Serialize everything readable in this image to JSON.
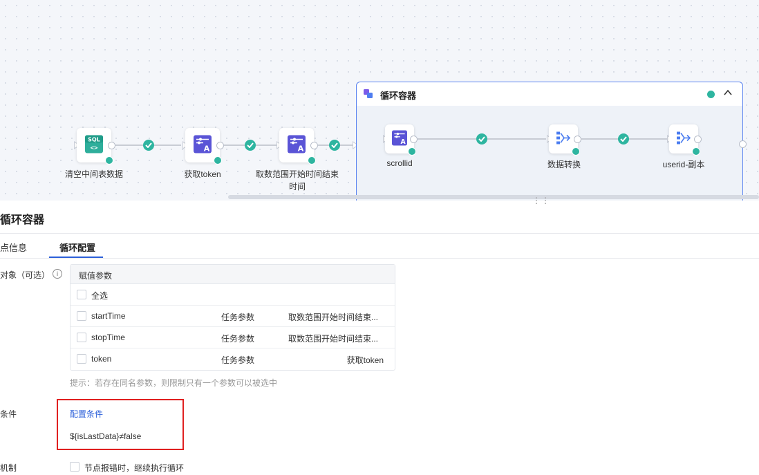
{
  "flow": {
    "nodes": [
      {
        "label": "清空中间表数据",
        "icon": "sql-icon",
        "icon_text": "SQL"
      },
      {
        "label": "获取token",
        "icon": "assign-icon"
      },
      {
        "label_line1": "取数范围开始时间结束",
        "label_line2": "时间",
        "icon": "assign-icon"
      }
    ],
    "container": {
      "title": "循环容器",
      "nodes": [
        {
          "label": "scrollid",
          "icon": "assign-icon"
        },
        {
          "label": "数据转换",
          "icon": "transform-icon"
        },
        {
          "label": "userid-副本",
          "icon": "transform-icon"
        }
      ]
    },
    "colors": {
      "status": "#2eb5a0",
      "accent": "#5b84f0",
      "link": "#2b5fd9",
      "highlight": "#e02020"
    }
  },
  "panel": {
    "title": "循环容器",
    "tabs": [
      {
        "label": "点信息",
        "active": false
      },
      {
        "label": "循环配置",
        "active": true
      }
    ],
    "assign": {
      "label": "对象（可选）",
      "table_header": "赋值参数",
      "select_all": "全选",
      "rows": [
        {
          "name": "startTime",
          "type": "任务参数",
          "source": "取数范围开始时间结束..."
        },
        {
          "name": "stopTime",
          "type": "任务参数",
          "source": "取数范围开始时间结束..."
        },
        {
          "name": "token",
          "type": "任务参数",
          "source": "获取token"
        }
      ],
      "hint": "提示：若存在同名参数，则限制只有一个参数可以被选中"
    },
    "condition": {
      "label": "条件",
      "link": "配置条件",
      "expression": "${isLastData}≠false"
    },
    "mechanism": {
      "label": "机制",
      "option": "节点报错时，继续执行循环"
    }
  }
}
